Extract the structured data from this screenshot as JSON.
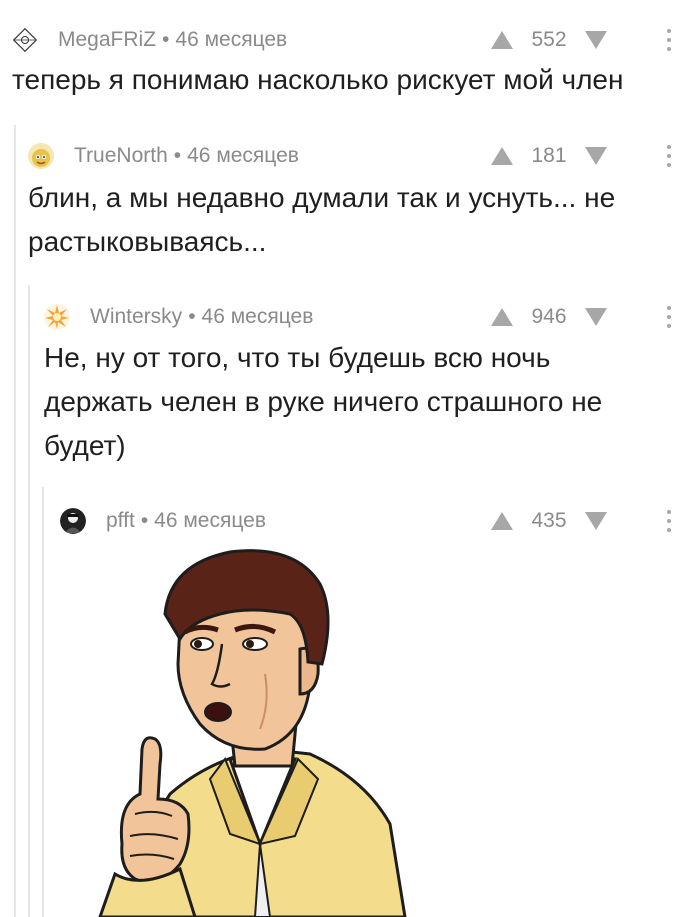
{
  "comments": [
    {
      "author": "MegaFRiZ",
      "time": "46 месяцев",
      "score": "552",
      "text": "теперь я понимаю насколько рискует мой член",
      "avatar_icon": "diamond-logo-icon"
    },
    {
      "author": "TrueNorth",
      "time": "46 месяцев",
      "score": "181",
      "text": "блин, а мы недавно думали так и уснуть... не\nрастыковываясь...",
      "avatar_icon": "yellow-creature-icon"
    },
    {
      "author": "Wintersky",
      "time": "46 месяцев",
      "score": "946",
      "text": "Не, ну от того, что ты будешь всю ночь\nдержать челен в руке ничего страшного не\nбудет)",
      "avatar_icon": "sunburst-icon"
    },
    {
      "author": "pfft",
      "time": "46 месяцев",
      "score": "435",
      "avatar_icon": "dark-figure-icon",
      "image": "cartoon-man-thumbs-up"
    }
  ],
  "separator": "•",
  "colors": {
    "meta_gray": "#8a8a8a",
    "thread_line": "#e6e6e6",
    "arrow_gray": "#a7a7a7",
    "jacket_yellow": "#f3dd8c",
    "hair_brown": "#5a2318",
    "skin": "#f2c49a"
  }
}
